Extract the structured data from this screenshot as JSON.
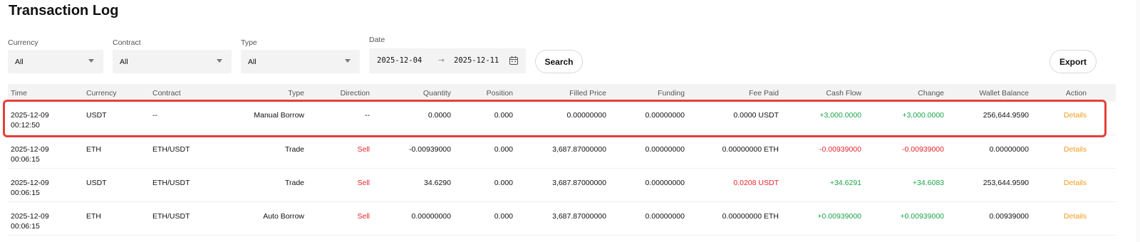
{
  "page": {
    "title": "Transaction Log"
  },
  "filters": {
    "currency": {
      "label": "Currency",
      "value": "All"
    },
    "contract": {
      "label": "Contract",
      "value": "All"
    },
    "type": {
      "label": "Type",
      "value": "All"
    },
    "date": {
      "label": "Date",
      "start": "2025-12-04",
      "arrow": "→",
      "end": "2025-12-11"
    },
    "search_label": "Search",
    "export_label": "Export"
  },
  "table": {
    "headers": [
      "Time",
      "Currency",
      "Contract",
      "Type",
      "Direction",
      "Quantity",
      "Position",
      "Filled Price",
      "Funding",
      "Fee Paid",
      "Cash Flow",
      "Change",
      "Wallet Balance",
      "Action"
    ],
    "rows": [
      {
        "date": "2025-12-09",
        "time": "00:12:50",
        "currency": "USDT",
        "contract": "--",
        "type": "Manual Borrow",
        "direction": "--",
        "quantity": "0.0000",
        "position": "0.000",
        "filled_price": "0.00000000",
        "funding": "0.00000000",
        "fee_paid": "0.0000 USDT",
        "cash_flow": "+3,000.0000",
        "change": "+3,000.0000",
        "wallet_balance": "256,644.9590",
        "action": "Details"
      },
      {
        "date": "2025-12-09",
        "time": "00:06:15",
        "currency": "ETH",
        "contract": "ETH/USDT",
        "type": "Trade",
        "direction": "Sell",
        "quantity": "-0.00939000",
        "position": "0.000",
        "filled_price": "3,687.87000000",
        "funding": "0.00000000",
        "fee_paid": "0.00000000 ETH",
        "cash_flow": "-0.00939000",
        "change": "-0.00939000",
        "wallet_balance": "0.00000000",
        "action": "Details"
      },
      {
        "date": "2025-12-09",
        "time": "00:06:15",
        "currency": "USDT",
        "contract": "ETH/USDT",
        "type": "Trade",
        "direction": "Sell",
        "quantity": "34.6290",
        "position": "0.000",
        "filled_price": "3,687.87000000",
        "funding": "0.00000000",
        "fee_paid": "0.0208 USDT",
        "cash_flow": "+34.6291",
        "change": "+34.6083",
        "wallet_balance": "253,644.9590",
        "action": "Details"
      },
      {
        "date": "2025-12-09",
        "time": "00:06:15",
        "currency": "ETH",
        "contract": "ETH/USDT",
        "type": "Auto Borrow",
        "direction": "Sell",
        "quantity": "0.00000000",
        "position": "0.000",
        "filled_price": "3,687.87000000",
        "funding": "0.00000000",
        "fee_paid": "0.00000000 ETH",
        "cash_flow": "+0.00939000",
        "change": "+0.00939000",
        "wallet_balance": "0.00939000",
        "action": "Details"
      }
    ]
  },
  "colors": {
    "positive": "#1aa34a",
    "negative": "#e5242b",
    "link": "#f39a1a",
    "highlight": "#e5403a"
  }
}
